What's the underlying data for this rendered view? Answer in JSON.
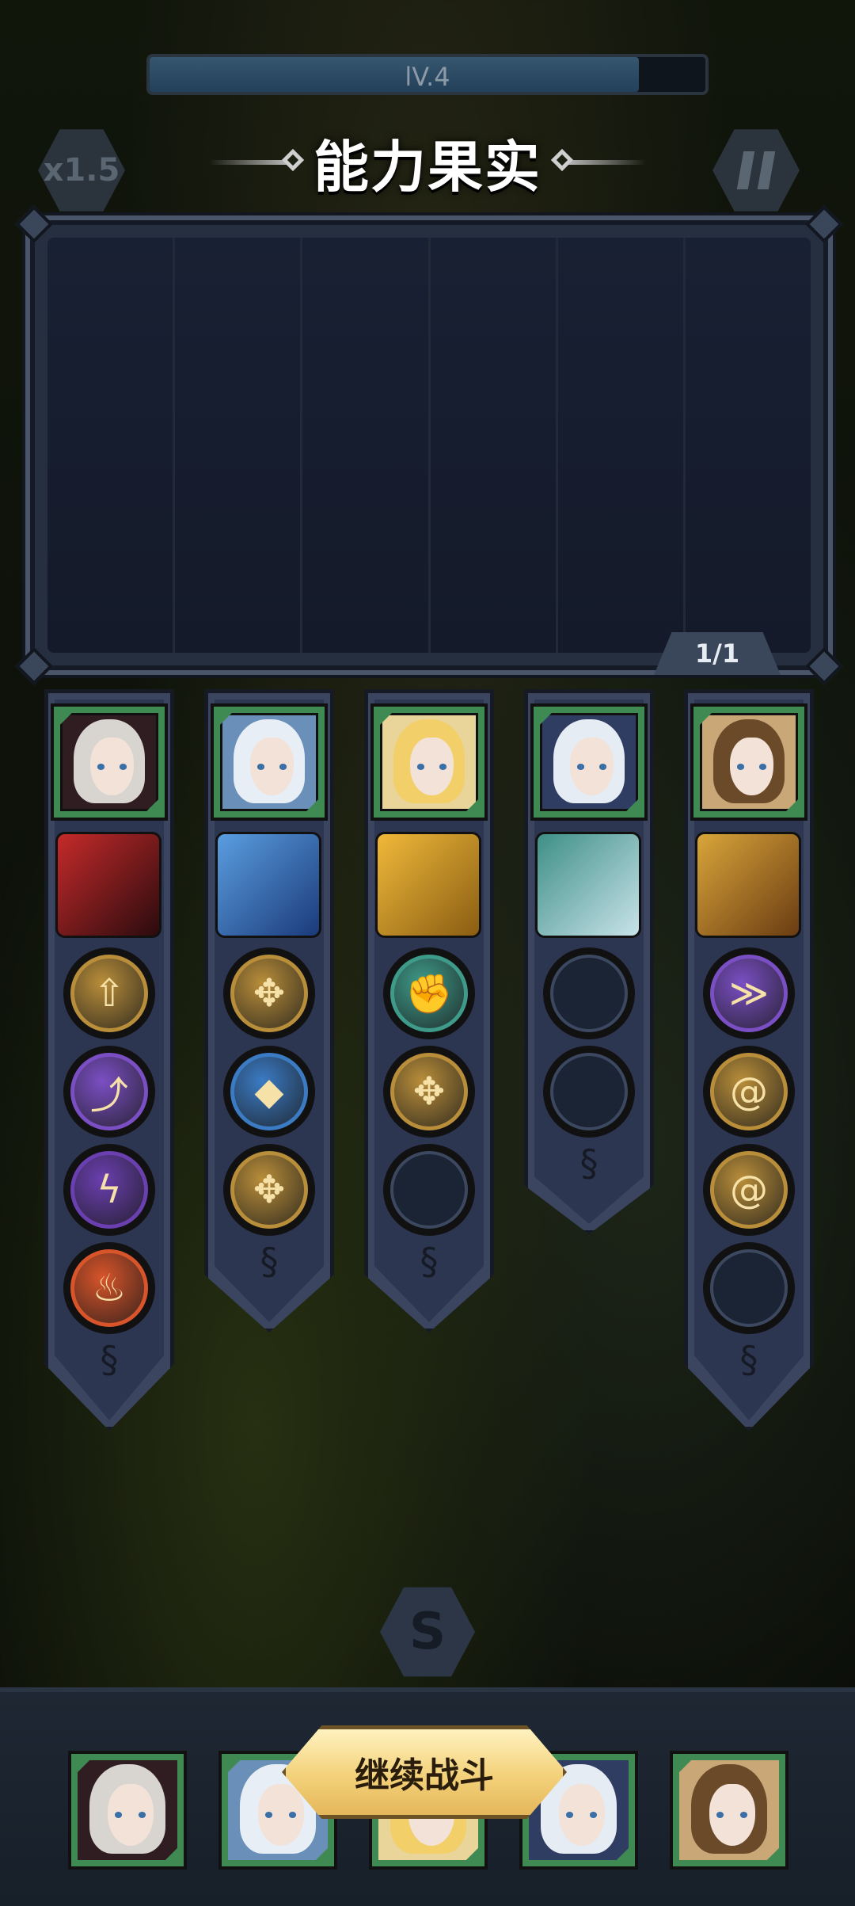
{
  "hud": {
    "level_label": "lV.4",
    "level_progress": 0.88,
    "speed_label": "x1.5"
  },
  "title": "能力果实",
  "fruit_panel": {
    "slot_count": 6,
    "page_counter": "1/1"
  },
  "heroes": [
    {
      "name": "vampire-lady",
      "hair": "#d8d4d0",
      "bg": "#2f1d22",
      "skill_colors": [
        "#c52a2a",
        "#2a0b0e"
      ],
      "orbs": [
        {
          "icon": "arrow-up-icon",
          "color": "#b98e3a"
        },
        {
          "icon": "split-arrow-icon",
          "color": "#7b4fc4"
        },
        {
          "icon": "lightning-icon",
          "color": "#6a3fb0"
        },
        {
          "icon": "fire-icon",
          "color": "#d8542a"
        }
      ]
    },
    {
      "name": "ice-queen",
      "hair": "#e8eef6",
      "bg": "#6a8fb8",
      "skill_colors": [
        "#5a9ee0",
        "#1b3a7a"
      ],
      "orbs": [
        {
          "icon": "four-arrows-icon",
          "color": "#b98e3a"
        },
        {
          "icon": "ice-crystal-icon",
          "color": "#3b7bc4"
        },
        {
          "icon": "four-arrows-icon",
          "color": "#b98e3a"
        }
      ]
    },
    {
      "name": "golden-priestess",
      "hair": "#f2cf68",
      "bg": "#e9d49a",
      "skill_colors": [
        "#f0b93a",
        "#8a5d12"
      ],
      "orbs": [
        {
          "icon": "fist-icon",
          "color": "#3e9b8a"
        },
        {
          "icon": "four-arrows-icon",
          "color": "#b98e3a"
        },
        {
          "icon": "empty-slot",
          "color": ""
        }
      ]
    },
    {
      "name": "white-dragon",
      "hair": "#e6ecf4",
      "bg": "#2f3d63",
      "skill_colors": [
        "#3e8f86",
        "#c8e3ea"
      ],
      "orbs": [
        {
          "icon": "empty-slot",
          "color": ""
        },
        {
          "icon": "empty-slot",
          "color": ""
        }
      ]
    },
    {
      "name": "laurel-goddess",
      "hair": "#6b4a2a",
      "bg": "#c9a777",
      "skill_colors": [
        "#d9a53a",
        "#6a3c12"
      ],
      "orbs": [
        {
          "icon": "purple-slash-icon",
          "color": "#7a4fc4"
        },
        {
          "icon": "spiral-icon",
          "color": "#b98e3a"
        },
        {
          "icon": "spiral-icon",
          "color": "#b98e3a"
        },
        {
          "icon": "empty-slot",
          "color": ""
        }
      ]
    }
  ],
  "continue_button": {
    "label": "继续战斗"
  },
  "colors": {
    "panel": "#262f40",
    "accent_gold": "#f3d17a",
    "portrait_frame": "#3f8a53"
  }
}
